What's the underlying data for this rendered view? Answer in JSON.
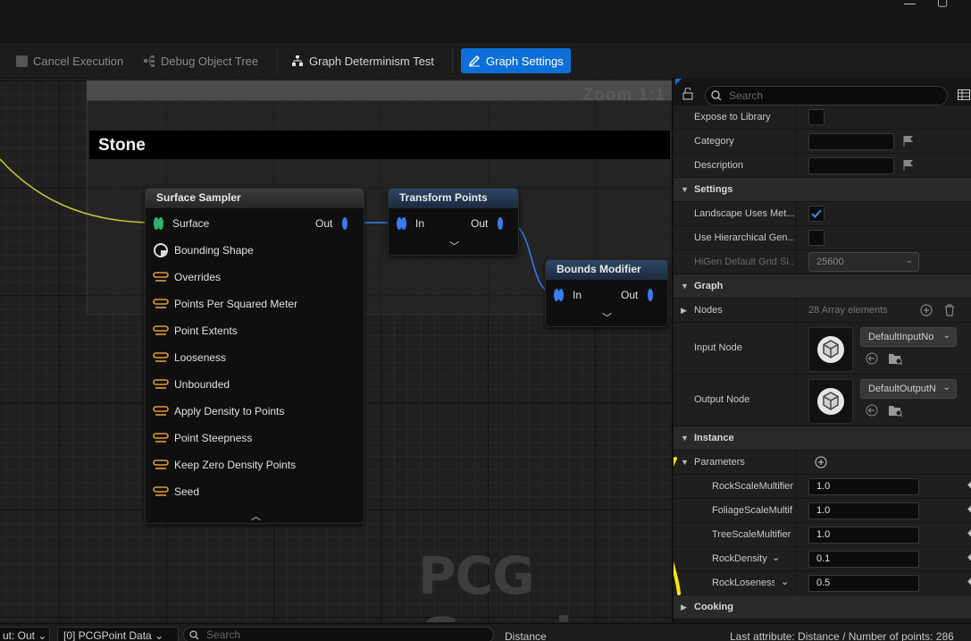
{
  "toolbar": {
    "cancel_execution": "Cancel Execution",
    "debug_object_tree": "Debug Object Tree",
    "graph_determinism_test": "Graph Determinism Test",
    "graph_settings": "Graph Settings"
  },
  "graph": {
    "zoom": "Zoom 1:1",
    "comment": "Stone",
    "watermark": "PCG Graph",
    "nodes": {
      "surface_sampler": {
        "title": "Surface Sampler",
        "inputs": [
          "Surface",
          "Bounding Shape",
          "Overrides",
          "Points Per Squared Meter",
          "Point Extents",
          "Looseness",
          "Unbounded",
          "Apply Density to Points",
          "Point Steepness",
          "Keep Zero Density Points",
          "Seed"
        ],
        "output": "Out"
      },
      "transform_points": {
        "title": "Transform Points",
        "input": "In",
        "output": "Out"
      },
      "bounds_modifier": {
        "title": "Bounds Modifier",
        "input": "In",
        "output": "Out"
      }
    }
  },
  "details": {
    "search_placeholder": "Search",
    "expose_to_library": "Expose to Library",
    "category": "Category",
    "description": "Description",
    "settings_section": "Settings",
    "landscape_uses_metadata": "Landscape Uses Met...",
    "use_hierarchical_generation": "Use Hierarchical Gen...",
    "higen_default_grid_size": "HiGen Default Grid Si...",
    "higen_grid_value": "25600",
    "graph_section": "Graph",
    "nodes_label": "Nodes",
    "nodes_value": "28 Array elements",
    "input_node": "Input Node",
    "input_node_value": "DefaultInputNo",
    "output_node": "Output Node",
    "output_node_value": "DefaultOutputN",
    "instance_section": "Instance",
    "parameters": "Parameters",
    "params": [
      {
        "name": "RockScaleMultifier",
        "value": "1.0"
      },
      {
        "name": "FoliageScaleMultif",
        "value": "1.0"
      },
      {
        "name": "TreeScaleMultifier",
        "value": "1.0"
      },
      {
        "name": "RockDensity",
        "value": "0.1"
      },
      {
        "name": "RockLoseness",
        "value": "0.5"
      }
    ],
    "cooking_section": "Cooking"
  },
  "statusbar": {
    "pin_select": "ut: Out",
    "data_select": "[0] PCGPoint Data",
    "search_placeholder": "Search",
    "column": "Distance",
    "info": "Last attribute: Distance / Number of points: 286"
  },
  "colors": {
    "accent": "#0e6fd8",
    "pin_blue": "#3b7cf0",
    "pin_green": "#2fb36a",
    "annotation_yellow": "#f5e800",
    "wire_yellow": "#c8c832"
  }
}
